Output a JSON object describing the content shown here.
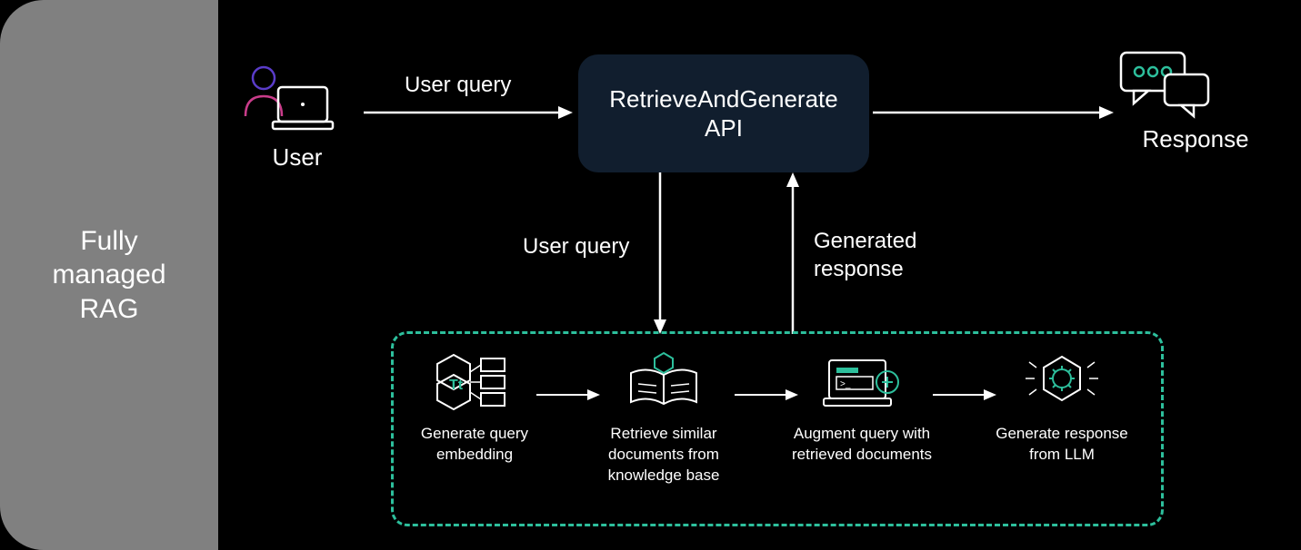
{
  "sidebar": {
    "title": "Fully\nmanaged\nRAG"
  },
  "user": {
    "label": "User"
  },
  "api": {
    "line1": "RetrieveAndGenerate",
    "line2": "API"
  },
  "response": {
    "label": "Response"
  },
  "arrows": {
    "user_to_api": "User query",
    "api_down": "User query",
    "pipeline_up_line1": "Generated",
    "pipeline_up_line2": "response"
  },
  "pipeline": {
    "steps": [
      {
        "label": "Generate query embedding"
      },
      {
        "label": "Retrieve similar documents from knowledge base"
      },
      {
        "label": "Augment query with retrieved documents"
      },
      {
        "label": "Generate response from LLM"
      }
    ]
  }
}
